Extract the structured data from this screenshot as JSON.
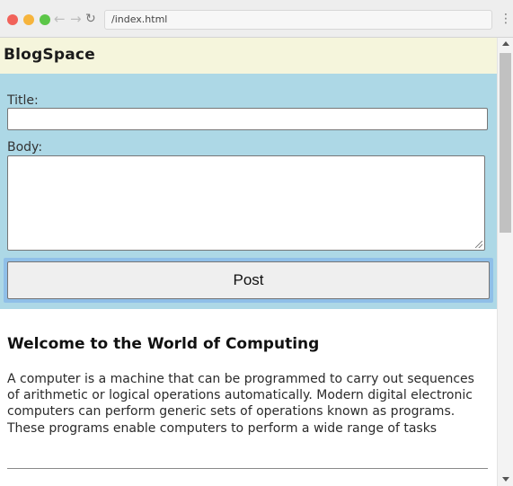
{
  "browser": {
    "url": "/index.html",
    "back_glyph": "←",
    "forward_glyph": "→",
    "reload_glyph": "↻",
    "menu_glyph": "⋮"
  },
  "header": {
    "brand": "BlogSpace"
  },
  "form": {
    "title_label": "Title:",
    "title_value": "",
    "body_label": "Body:",
    "body_value": "",
    "post_label": "Post"
  },
  "article": {
    "title": "Welcome to the World of Computing",
    "body": "A computer is a machine that can be programmed to carry out sequences of arithmetic or logical operations automatically. Modern digital electronic computers can perform generic sets of operations known as programs. These programs enable computers to perform a wide range of tasks"
  },
  "colors": {
    "header_bg": "#f5f5dc",
    "form_bg": "#add8e6",
    "button_focus_ring": "#8fbfe8"
  }
}
